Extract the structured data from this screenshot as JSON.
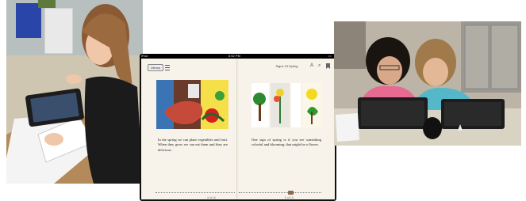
{
  "ibooks": {
    "status_left": "iPad",
    "status_time": "8:52 PM",
    "library_label": "Library",
    "book_title": "Signs Of Spring",
    "tool_font": "A",
    "tool_search": "⌕",
    "left_page": {
      "text": "In the spring we can plant vegetables and fruit. When they grow we can eat them and they are delicious.",
      "page_number": "4 of 16"
    },
    "right_page": {
      "text": "One sign of spring is if you see something colorful and blooming, that might be a flower.",
      "page_number": "5 of 16"
    }
  },
  "colors": {
    "page": "#f7f3ea",
    "device_bezel": "#111111",
    "desk": "#8a6b4e"
  }
}
